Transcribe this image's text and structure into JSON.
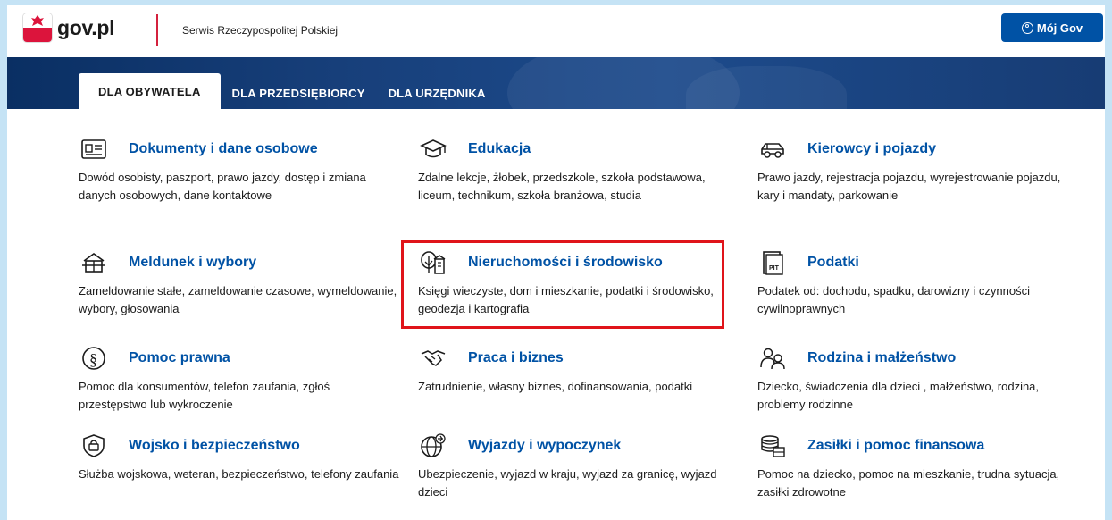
{
  "header": {
    "logo_text": "gov.pl",
    "subtitle": "Serwis Rzeczypospolitej Polskiej",
    "login_label": "Mój Gov"
  },
  "tabs": [
    {
      "label": "DLA OBYWATELA",
      "active": true
    },
    {
      "label": "DLA PRZEDSIĘBIORCY",
      "active": false
    },
    {
      "label": "DLA URZĘDNIKA",
      "active": false
    }
  ],
  "colors": {
    "link": "#0052a5",
    "highlight": "#e0141a"
  },
  "tiles": [
    {
      "icon": "id-card-icon",
      "title": "Dokumenty i dane osobowe",
      "desc": "Dowód osobisty, paszport, prawo jazdy, dostęp i zmiana danych osobowych, dane kontaktowe"
    },
    {
      "icon": "graduation-cap-icon",
      "title": "Edukacja",
      "desc": "Zdalne lekcje, żłobek, przedszkole, szkoła podstawowa, liceum, technikum, szkoła branżowa, studia"
    },
    {
      "icon": "car-icon",
      "title": "Kierowcy i pojazdy",
      "desc": "Prawo jazdy, rejestracja pojazdu, wyrejestrowanie pojazdu, kary i mandaty, parkowanie"
    },
    {
      "icon": "house-icon",
      "title": "Meldunek i wybory",
      "desc": "Zameldowanie stałe, zameldowanie czasowe, wymeldowanie, wybory, głosowania"
    },
    {
      "icon": "tree-building-icon",
      "title": "Nieruchomości i środowisko",
      "desc": "Księgi wieczyste, dom i mieszkanie, podatki i środowisko, geodezja i kartografia"
    },
    {
      "icon": "pit-document-icon",
      "title": "Podatki",
      "desc": "Podatek od: dochodu, spadku, darowizny i czynności cywilnoprawnych"
    },
    {
      "icon": "paragraph-icon",
      "title": "Pomoc prawna",
      "desc": "Pomoc dla konsumentów, telefon zaufania, zgłoś przestępstwo lub wykroczenie"
    },
    {
      "icon": "handshake-icon",
      "title": "Praca i biznes",
      "desc": "Zatrudnienie, własny biznes, dofinansowania, podatki"
    },
    {
      "icon": "family-icon",
      "title": "Rodzina i małżeństwo",
      "desc": "Dziecko, świadczenia dla dzieci , małżeństwo, rodzina, problemy rodzinne"
    },
    {
      "icon": "shield-lock-icon",
      "title": "Wojsko i bezpieczeństwo",
      "desc": "Służba wojskowa, weteran, bezpieczeństwo, telefony zaufania"
    },
    {
      "icon": "globe-plane-icon",
      "title": "Wyjazdy i wypoczynek",
      "desc": "Ubezpieczenie, wyjazd w kraju, wyjazd za granicę, wyjazd dzieci"
    },
    {
      "icon": "coins-icon",
      "title": "Zasiłki i pomoc finansowa",
      "desc": "Pomoc na dziecko, pomoc na mieszkanie, trudna sytuacja, zasiłki zdrowotne"
    }
  ]
}
